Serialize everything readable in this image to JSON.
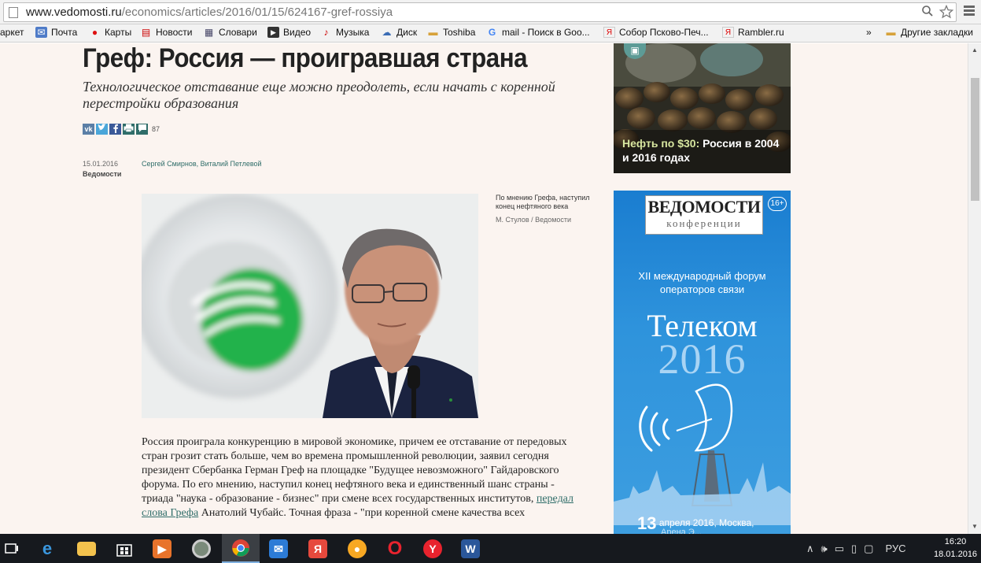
{
  "browser": {
    "url_domain": "www.vedomosti.ru",
    "url_path": "/economics/articles/2016/01/15/624167-gref-rossiya",
    "search_icon": "search-icon",
    "star_icon": "star-icon",
    "menu_icon": "hamburger-menu-icon"
  },
  "bookmarks": [
    {
      "label": "аркет",
      "icon": "market-icon"
    },
    {
      "label": "Почта",
      "icon": "mail-icon"
    },
    {
      "label": "Карты",
      "icon": "map-pin-icon"
    },
    {
      "label": "Новости",
      "icon": "news-icon"
    },
    {
      "label": "Словари",
      "icon": "dictionary-icon"
    },
    {
      "label": "Видео",
      "icon": "video-icon"
    },
    {
      "label": "Музыка",
      "icon": "music-icon"
    },
    {
      "label": "Диск",
      "icon": "disk-icon"
    },
    {
      "label": "Toshiba",
      "icon": "folder-icon"
    },
    {
      "label": "mail - Поиск в Goo...",
      "icon": "google-icon"
    },
    {
      "label": "Собор Псково-Печ...",
      "icon": "yandex-icon"
    },
    {
      "label": "Rambler.ru",
      "icon": "yandex-icon"
    }
  ],
  "bookmarks_overflow": "»",
  "other_bookmarks": "Другие закладки",
  "article": {
    "headline": "Греф: Россия — проигравшая страна",
    "subtitle": "Технологическое отставание еще можно преодолеть, если начать с коренной перестройки образования",
    "social": {
      "vk": "vk",
      "comments_count": "87"
    },
    "date": "15.01.2016",
    "source": "Ведомости",
    "authors": "Сергей Смирнов, Виталий Петлевой",
    "photo_caption": "По мнению Грефа, наступил конец нефтяного века",
    "photo_credit": "М. Стулов / Ведомости",
    "body_part1": "Россия проиграла конкуренцию в мировой экономике, причем ее отставание от передовых стран грозит стать больше, чем во времена промышленной революции, заявил сегодня президент Сбербанка Герман Греф на площадке \"Будущее невозможного\" Гайдаровского форума. По его мнению, наступил конец нефтяного века и единственный шанс страны - триада \"наука - образование - бизнес\" при смене всех государственных институтов, ",
    "body_link": "передал слова Грефа",
    "body_part2": " Анатолий Чубайс. Точная фраза - \"при коренной смене качества всех"
  },
  "promo": {
    "accent": "Нефть по $30:",
    "title": " Россия в 2004 и 2016 годах"
  },
  "ad": {
    "logo_title": "ВЕДОМОСТИ",
    "logo_sub": "конференции",
    "age": "16+",
    "forum": "XII международный форум операторов связи",
    "telecom": "Телеком",
    "year": "2016",
    "date_day": "13",
    "date_text": "апреля 2016, Москва,",
    "date_text2": "Арена Э..."
  },
  "taskbar": {
    "tray_lang": "РУС",
    "time": "16:20",
    "date": "18.01.2016"
  },
  "colors": {
    "page_bg": "#fbf4f0",
    "link": "#2f6d69",
    "ad_blue": "#2e93dc",
    "taskbar": "#16191e"
  }
}
